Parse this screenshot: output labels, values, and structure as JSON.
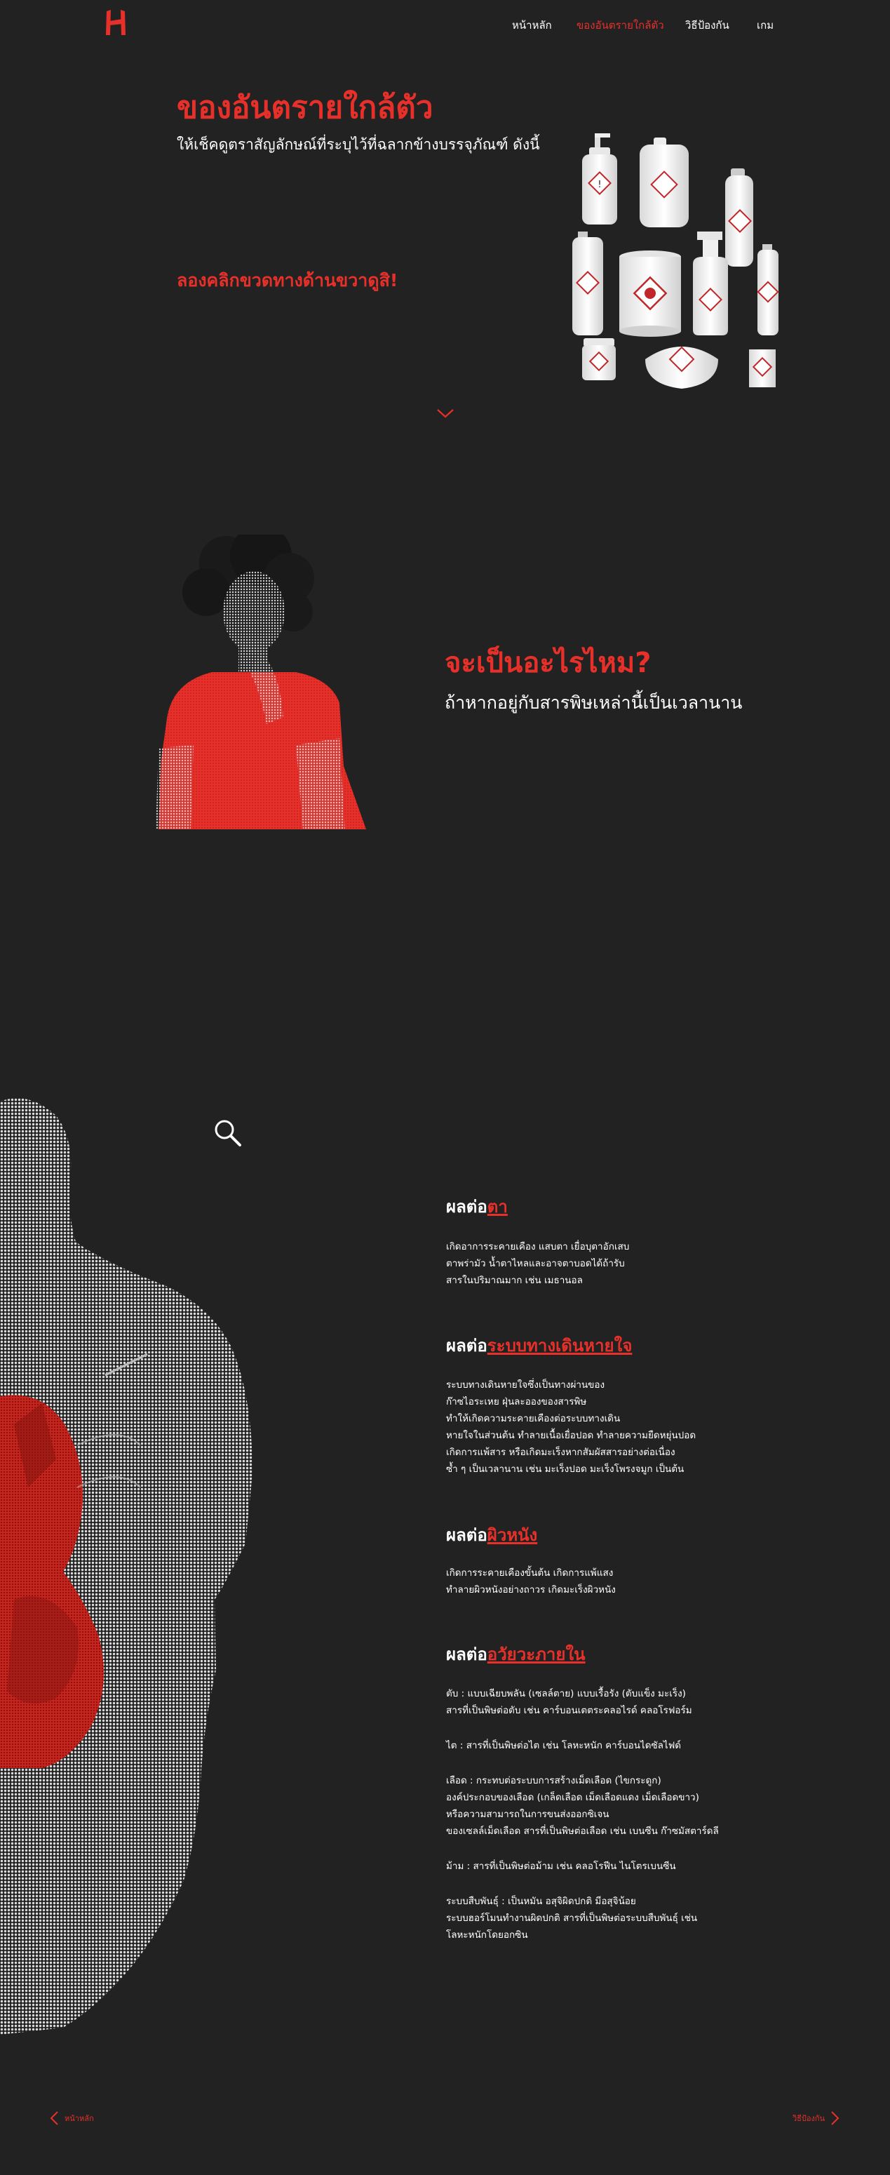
{
  "nav": {
    "logo_alt": "H",
    "items": [
      "หน้าหลัก",
      "ของอันตรายใกล้ตัว",
      "วิธีป้องกัน",
      "เกม"
    ],
    "active_index": 1
  },
  "colors": {
    "accent": "#e8302a",
    "background": "#222222",
    "text": "#ffffff"
  },
  "hero": {
    "title": "ของอันตรายใกล้ตัว",
    "subtitle": "ให้เช็คดูตราสัญลักษณ์ที่ระบุไว้ที่ฉลากข้างบรรจุภัณฑ์ ดังนี้",
    "cta": "ลองคลิกขวดทางด้านขวาดูสิ!"
  },
  "question": {
    "title": "จะเป็นอะไรไหม?",
    "subtitle": "ถ้าหากอยู่กับสารพิษเหล่านี้เป็นเวลานาน"
  },
  "effects": [
    {
      "prefix": "ผลต่อ",
      "highlight": "ตา",
      "paragraphs": [
        [
          "เกิดอาการระคายเคือง แสบตา เยื่อบุตาอักเสบ",
          "ตาพร่ามัว น้ำตาไหลและอาจตาบอดได้ถ้ารับ",
          "สารในปริมาณมาก เช่น เมธานอล"
        ]
      ]
    },
    {
      "prefix": "ผลต่อ",
      "highlight": "ระบบทางเดินหายใจ",
      "paragraphs": [
        [
          "ระบบทางเดินหายใจซึ่งเป็นทางผ่านของ",
          "ก๊าซไอระเหย ฝุ่นละอองของสารพิษ",
          "ทำให้เกิดความระคายเคืองต่อระบบทางเดิน",
          "หายใจในส่วนต้น ทำลายเนื้อเยื่อปอด ทำลายความยืดหยุ่นปอด",
          "เกิดการแพ้สาร หรือเกิดมะเร็งหากสัมผัสสารอย่างต่อเนื่อง",
          "ซ้ำ ๆ เป็นเวลานาน เช่น มะเร็งปอด มะเร็งโพรงจมูก เป็นต้น"
        ]
      ]
    },
    {
      "prefix": "ผลต่อ",
      "highlight": "ผิวหนัง",
      "paragraphs": [
        [
          "เกิดการระคายเคืองขั้นต้น เกิดการแพ้แสง",
          "ทำลายผิวหนังอย่างถาวร เกิดมะเร็งผิวหนัง"
        ]
      ]
    },
    {
      "prefix": "ผลต่อ",
      "highlight": "อวัยวะภายใน",
      "paragraphs": [
        [
          "ตับ : แบบเฉียบพลัน (เซลล์ตาย) แบบเรื้อรัง (ตับแข็ง มะเร็ง)",
          "สารที่เป็นพิษต่อตับ เช่น คาร์บอนเตตระคลอไรด์ คลอโรฟอร์ม"
        ],
        [
          "ไต : สารที่เป็นพิษต่อไต เช่น โลหะหนัก คาร์บอนไดซัลไฟด์"
        ],
        [
          "เลือด : กระทบต่อระบบการสร้างเม็ดเลือด (ไขกระดูก)",
          "องค์ประกอบของเลือด (เกล็ดเลือด เม็ดเลือดแดง เม็ดเลือดขาว)",
          "หรือความสามารถในการขนส่งออกซิเจน",
          "ของเซลล์เม็ดเลือด สารที่เป็นพิษต่อเลือด เช่น เบนซีน ก๊าซมัสตาร์ดลี"
        ],
        [
          "ม้าม : สารที่เป็นพิษต่อม้าม เช่น คลอโรฟีน ไนโตรเบนซีน"
        ],
        [
          "ระบบสืบพันธุ์ : เป็นหมัน อสุจิผิดปกติ มีอสุจิน้อย",
          "ระบบฮอร์โมนทำงานผิดปกติ สารที่เป็นพิษต่อระบบสืบพันธุ์ เช่น",
          "โลหะหนักโดยอกซิน"
        ]
      ]
    }
  ],
  "footer": {
    "prev": "หน้าหลัก",
    "next": "วิธีป้องกัน"
  }
}
